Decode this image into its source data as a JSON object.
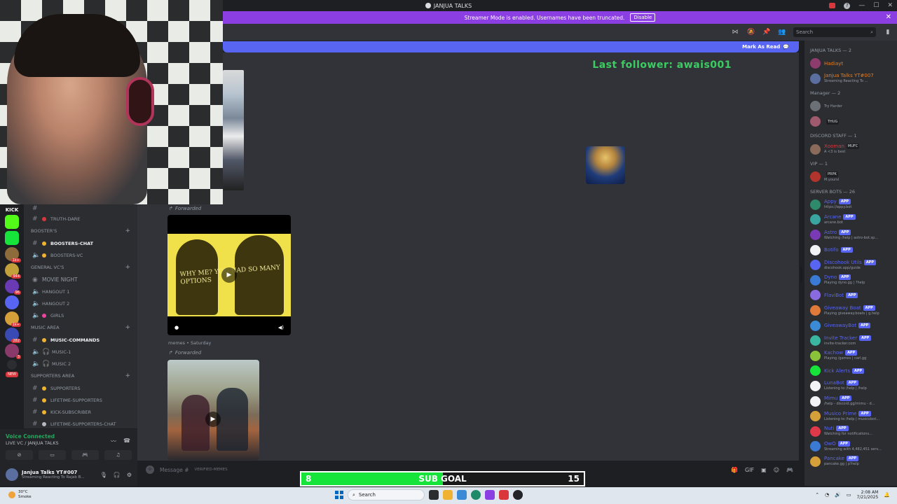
{
  "window": {
    "title": "JANJUA TALKS"
  },
  "streamer_banner": {
    "text": "Streamer Mode is enabled. Usernames have been truncated.",
    "button": "Disable"
  },
  "header": {
    "search_placeholder": "Search"
  },
  "mark_read": {
    "label": "Mark As Read"
  },
  "overlay": {
    "last_follower": "Last follower: awais001"
  },
  "messages": {
    "forwarded_label": "Forwarded",
    "forwarded_label_2": "Forwarded",
    "video_caption": "WHY ME? YOU HAD SO MANY OPTIONS",
    "memes_meta": "memes • Saturday"
  },
  "channels": [
    {
      "type": "text",
      "name": "truth-dare",
      "bold": false,
      "color": "#da373c"
    },
    {
      "type": "category",
      "name": "BOOSTER's"
    },
    {
      "type": "text",
      "name": "boosters-chat",
      "bold": true,
      "color": "#f0b232"
    },
    {
      "type": "text",
      "name": "boosters-vc",
      "bold": false,
      "color": "#f0b232"
    },
    {
      "type": "category",
      "name": "GENERAL VC's"
    },
    {
      "type": "stage",
      "name": "MOVIE NIGHT"
    },
    {
      "type": "voice",
      "name": "hangout 1",
      "color": "#b5bac1"
    },
    {
      "type": "voice",
      "name": "hangout 2",
      "color": "#b5bac1"
    },
    {
      "type": "voice",
      "name": "girls",
      "color": "#eb459e"
    },
    {
      "type": "category",
      "name": "MUSIC AREA"
    },
    {
      "type": "text",
      "name": "music-commands",
      "bold": true,
      "color": "#f0b232"
    },
    {
      "type": "voice",
      "name": "music-1",
      "color": "#b5bac1"
    },
    {
      "type": "voice",
      "name": "music 2",
      "color": "#b5bac1"
    },
    {
      "type": "category",
      "name": "SUPPORTERS AREA"
    },
    {
      "type": "text",
      "name": "supporters",
      "bold": false,
      "color": "#f0b232"
    },
    {
      "type": "text",
      "name": "lifetime-supporters",
      "bold": false,
      "color": "#f0b232"
    },
    {
      "type": "text",
      "name": "kick-subscriber",
      "bold": false,
      "color": "#f0b232"
    },
    {
      "type": "text",
      "name": "lifetime-supporters-chat",
      "bold": false,
      "color": "#b5bac1"
    }
  ],
  "voice_panel": {
    "status": "Voice Connected",
    "channel": "LIVE VC / JANJUA TALKS"
  },
  "user_panel": {
    "name": "Janjua Talks YT#007",
    "status": "Streaming Reacting To Rajab B..."
  },
  "message_input": {
    "placeholder": "Message #",
    "channel": "verified-memes"
  },
  "members": [
    {
      "group": "JANJUA TALKS — 2",
      "items": [
        {
          "name": "Hadiayt",
          "sub": "",
          "color": "#e67e22",
          "av": "#8e3c6e",
          "tag": ""
        },
        {
          "name": "Janjua Talks YT#007",
          "sub": "Streaming Reacting To ...",
          "color": "#e67e22",
          "av": "#5b6ea0",
          "tag": ""
        }
      ]
    },
    {
      "group": "Manager — 2",
      "items": [
        {
          "name": "",
          "sub": "Try Harder",
          "color": "#dbdee1",
          "av": "#6b6f76",
          "tag": ""
        },
        {
          "name": "",
          "sub": "",
          "color": "#dbdee1",
          "av": "#a05a6e",
          "tag": "THUG"
        }
      ]
    },
    {
      "group": "DISCORD STAFF — 1",
      "items": [
        {
          "name": "Xooman",
          "sub": "A <3 is best",
          "color": "#da373c",
          "av": "#8a6a5a",
          "tag": "MUFC"
        }
      ]
    },
    {
      "group": "VIP — 1",
      "items": [
        {
          "name": "",
          "sub": "M.yoursl",
          "color": "#dbdee1",
          "av": "#b3342c",
          "tag": "PRPK"
        }
      ]
    },
    {
      "group": "SERVER BOTS — 26",
      "items": [
        {
          "name": "Appy",
          "sub": "https://appy.bot",
          "color": "#5865f2",
          "av": "#2e8a6a",
          "tag": "APP"
        },
        {
          "name": "Arcane",
          "sub": "arcane.bot",
          "color": "#5865f2",
          "av": "#3aa5a0",
          "tag": "APP"
        },
        {
          "name": "Astro",
          "sub": "Watching /help | astro-bot.sp...",
          "color": "#5865f2",
          "av": "#7a3ab5",
          "tag": "APP"
        },
        {
          "name": "Botifo",
          "sub": "",
          "color": "#5865f2",
          "av": "#f2f3f5",
          "tag": "APP"
        },
        {
          "name": "Discohook Utils",
          "sub": "discohook.app/guide",
          "color": "#5865f2",
          "av": "#5865f2",
          "tag": "APP"
        },
        {
          "name": "Dyno",
          "sub": "Playing dyno.gg | ?help",
          "color": "#5865f2",
          "av": "#3a7ad5",
          "tag": "APP"
        },
        {
          "name": "FlaviBot",
          "sub": "",
          "color": "#5865f2",
          "av": "#8a6ae0",
          "tag": "APP"
        },
        {
          "name": "Giveaway Boat",
          "sub": "Playing giveaway.boats | g.help",
          "color": "#5865f2",
          "av": "#e07a3a",
          "tag": "APP"
        },
        {
          "name": "GiveawayBot",
          "sub": "",
          "color": "#5865f2",
          "av": "#3a8ad5",
          "tag": "APP"
        },
        {
          "name": "Invite Tracker",
          "sub": "invite-tracker.com",
          "color": "#5865f2",
          "av": "#3ab5a0",
          "tag": "APP"
        },
        {
          "name": "Kachow",
          "sub": "Playing /games | carl.gg",
          "color": "#5865f2",
          "av": "#8ac23a",
          "tag": "APP"
        },
        {
          "name": "Kick Alerts",
          "sub": "",
          "color": "#5865f2",
          "av": "#16e43a",
          "tag": "APP"
        },
        {
          "name": "LunaBot",
          "sub": "Listening to /help | /help",
          "color": "#5865f2",
          "av": "#f2f3f5",
          "tag": "APP"
        },
        {
          "name": "Mimu",
          "sub": "/help - discord.gg/mimu - d...",
          "color": "#5865f2",
          "av": "#f2f3f5",
          "tag": "APP"
        },
        {
          "name": "Musico Prime",
          "sub": "Listening to /help | musicobot...",
          "color": "#5865f2",
          "av": "#d5a03a",
          "tag": "APP"
        },
        {
          "name": "Nuti",
          "sub": "Watching for notifications...",
          "color": "#5865f2",
          "av": "#e03a4a",
          "tag": "APP"
        },
        {
          "name": "OwO",
          "sub": "Streaming with 4,482,451 serv...",
          "color": "#5865f2",
          "av": "#3a7ad5",
          "tag": "APP"
        },
        {
          "name": "Pancake",
          "sub": "pancake.gg | p!help",
          "color": "#5865f2",
          "av": "#d5a03a",
          "tag": "APP"
        }
      ]
    }
  ],
  "sub_goal": {
    "current": "8",
    "label": "SUB GOAL",
    "target": "15",
    "progress": 0.5
  },
  "taskbar": {
    "temp": "30°C",
    "weather": "Smoke",
    "search": "Search",
    "time": "2:08 AM",
    "date": "7/21/2025"
  },
  "colors": {
    "accent": "#5865f2",
    "streamer_purple": "#8b3fe3",
    "goal_green": "#16e43a"
  }
}
